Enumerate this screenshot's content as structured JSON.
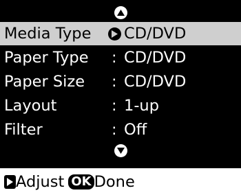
{
  "menu": {
    "rows": [
      {
        "label": "Media Type",
        "separator": "",
        "value": "CD/DVD",
        "selected": true
      },
      {
        "label": "Paper Type",
        "separator": ":",
        "value": "CD/DVD",
        "selected": false
      },
      {
        "label": "Paper Size",
        "separator": ":",
        "value": "CD/DVD",
        "selected": false
      },
      {
        "label": "Layout",
        "separator": ":",
        "value": "1-up",
        "selected": false
      },
      {
        "label": "Filter",
        "separator": ":",
        "value": "Off",
        "selected": false
      }
    ]
  },
  "footer": {
    "adjust_label": "Adjust",
    "ok_badge": "OK",
    "done_label": "Done"
  },
  "icons": {
    "scroll_up": "up-arrow-icon",
    "scroll_down": "down-arrow-icon",
    "selection": "right-arrow-icon",
    "adjust": "right-arrow-icon"
  },
  "colors": {
    "screen_bg": "#000000",
    "selected_row_bg": "#cfcfcf",
    "text": "#ffffff",
    "footer_bg": "#ffffff"
  }
}
